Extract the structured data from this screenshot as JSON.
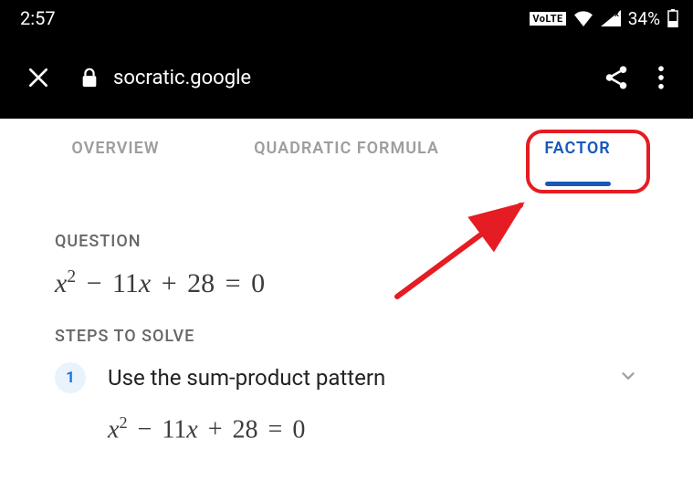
{
  "status": {
    "time": "2:57",
    "volte": "VoLTE",
    "battery_pct": "34%"
  },
  "header": {
    "url": "socratic.google"
  },
  "tabs": {
    "items": [
      {
        "label": "OVERVIEW"
      },
      {
        "label": "QUADRATIC FORMULA"
      },
      {
        "label": "FACTOR"
      }
    ],
    "active_index": 2
  },
  "content": {
    "question_label": "QUESTION",
    "steps_label": "STEPS TO SOLVE",
    "equation": {
      "a": "x",
      "exp": "2",
      "b": "11",
      "c": "28",
      "rhs": "0",
      "minus": "−",
      "plus": "+",
      "eq": "="
    },
    "step1": {
      "num": "1",
      "title": "Use the sum-product pattern"
    }
  },
  "colors": {
    "accent": "#1858b8",
    "highlight": "#e51c23"
  }
}
